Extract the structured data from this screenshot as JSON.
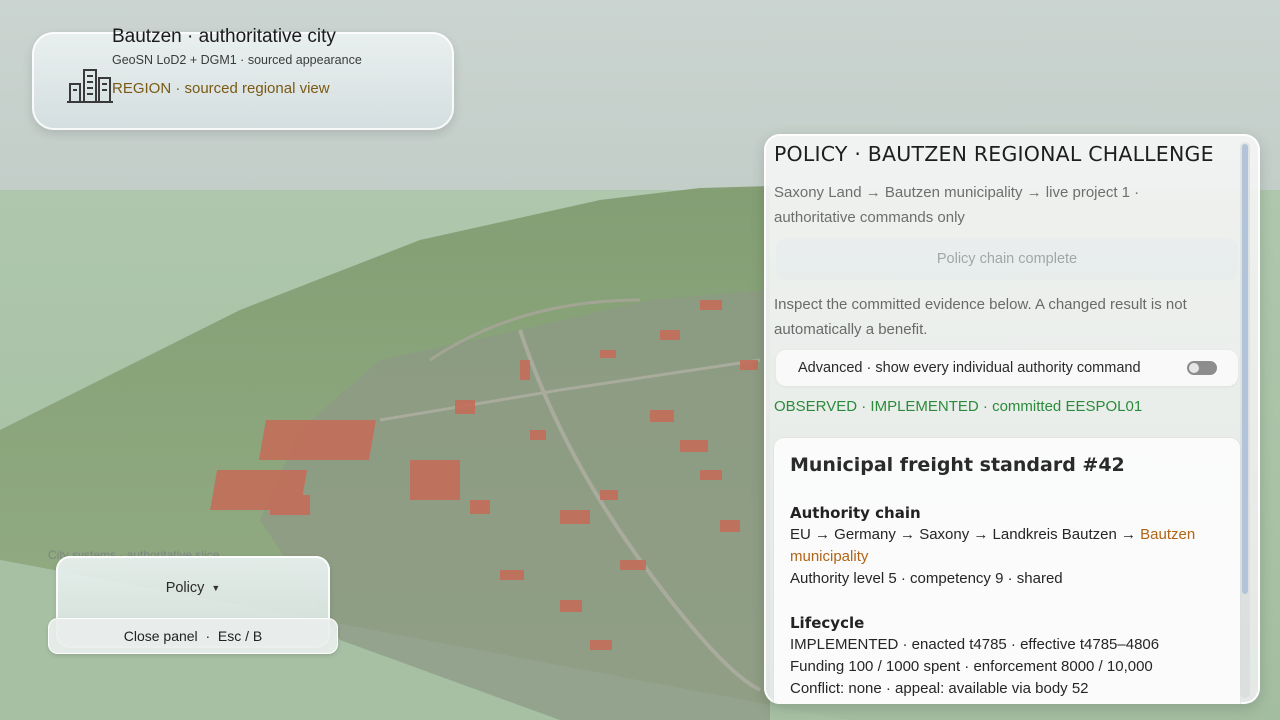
{
  "header": {
    "title": "Bautzen · authoritative city",
    "subtitle": "GeoSN LoD2 + DGM1 · sourced appearance",
    "region": "REGION · sourced regional view",
    "icon": "city-buildings-icon"
  },
  "controls": {
    "systems_label": "City systems · authoritative slice",
    "dropdown_label": "Policy",
    "close_label": "Close panel  ·  Esc / B"
  },
  "panel": {
    "title": "POLICY · BAUTZEN REGIONAL CHALLENGE",
    "path": "Saxony Land → Bautzen municipality → live project 1 · authoritative commands only",
    "chain_button": "Policy chain complete",
    "inspect_text": "Inspect the committed evidence below. A changed result is not automatically a benefit.",
    "advanced_label": "Advanced · show every individual authority command",
    "advanced_enabled": false,
    "observed_status": "OBSERVED · IMPLEMENTED · committed EESPOL01",
    "card": {
      "title": "Municipal freight standard #42",
      "authority_head": "Authority chain",
      "authority_chain_prefix": "EU → Germany → Saxony → Landkreis Bautzen →",
      "authority_chain_highlight": "Bautzen municipality",
      "authority_level": "Authority level 5 · competency 9 · shared",
      "lifecycle_head": "Lifecycle",
      "lifecycle_status": "IMPLEMENTED · enacted t4785 · effective t4785–4806",
      "funding": "Funding 100 / 1000 spent · enforcement 8000 / 10,000",
      "conflict": "Conflict: none · appeal: available via body 52"
    }
  },
  "colors": {
    "accent_region": "#7a5a14",
    "observed_green": "#2c8a3c",
    "municipality_orange": "#b06416"
  }
}
